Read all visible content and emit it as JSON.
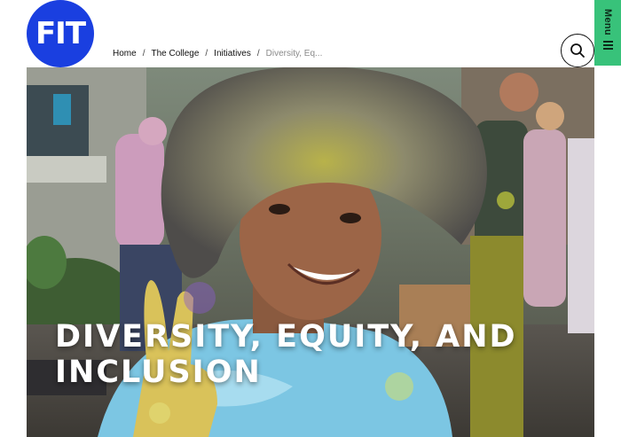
{
  "header": {
    "logo_text": "FIT",
    "menu_label": "Menu"
  },
  "breadcrumb": {
    "items": [
      "Home",
      "The College",
      "Initiatives"
    ],
    "current": "Diversity, Eq...",
    "separator": "/"
  },
  "hero": {
    "title_line1": "Diversity, Equity, and",
    "title_line2": "Inclusion"
  },
  "icons": {
    "search": "search-icon",
    "menu": "hamburger-icon"
  },
  "colors": {
    "brand_blue": "#1a3fe0",
    "menu_green": "#38c27a"
  }
}
